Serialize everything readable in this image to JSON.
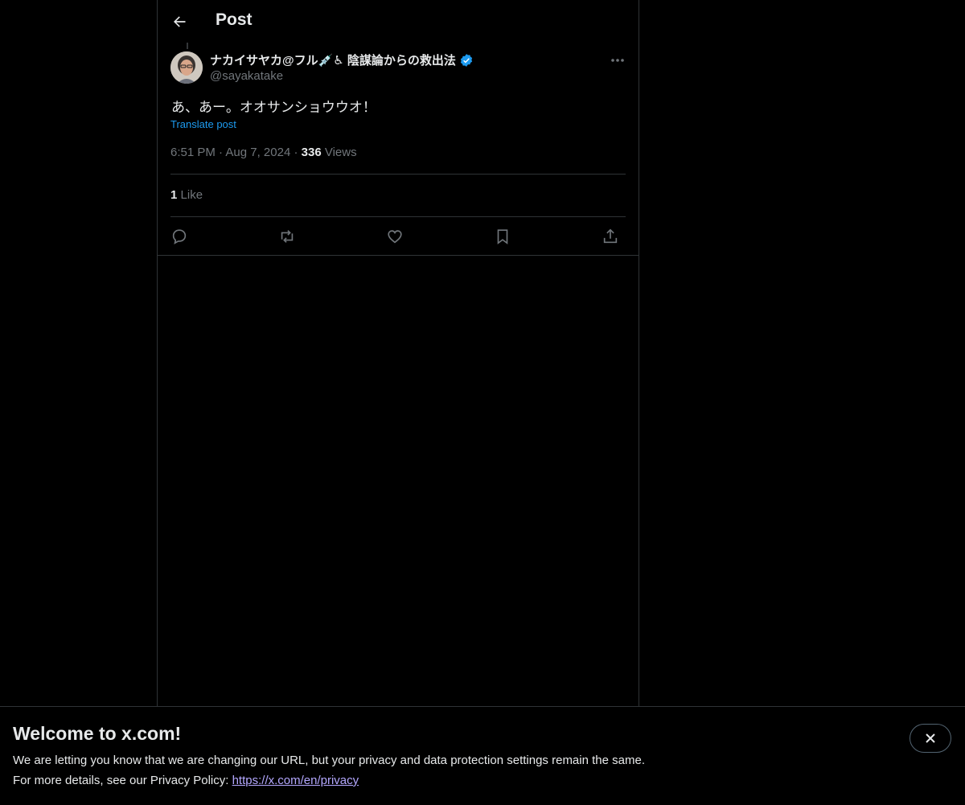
{
  "header": {
    "title": "Post"
  },
  "post": {
    "author_name": "ナカイサヤカ@フル💉♿ 陰謀論からの救出法",
    "author_handle": "@sayakatake",
    "text": "あ、あー。オオサンショウウオ！",
    "translate_label": "Translate post",
    "time": "6:51 PM",
    "date": "Aug 7, 2024",
    "views_count": "336",
    "views_label": "Views",
    "likes_count": "1",
    "likes_label": "Like"
  },
  "colors": {
    "accent": "#1d9bf0",
    "link": "#b4a8ff",
    "border": "#2f3336",
    "muted": "#71767b"
  },
  "banner": {
    "title": "Welcome to x.com!",
    "line1": "We are letting you know that we are changing our URL, but your privacy and data protection settings remain the same.",
    "line2_prefix": "For more details, see our Privacy Policy: ",
    "link_text": "https://x.com/en/privacy"
  }
}
